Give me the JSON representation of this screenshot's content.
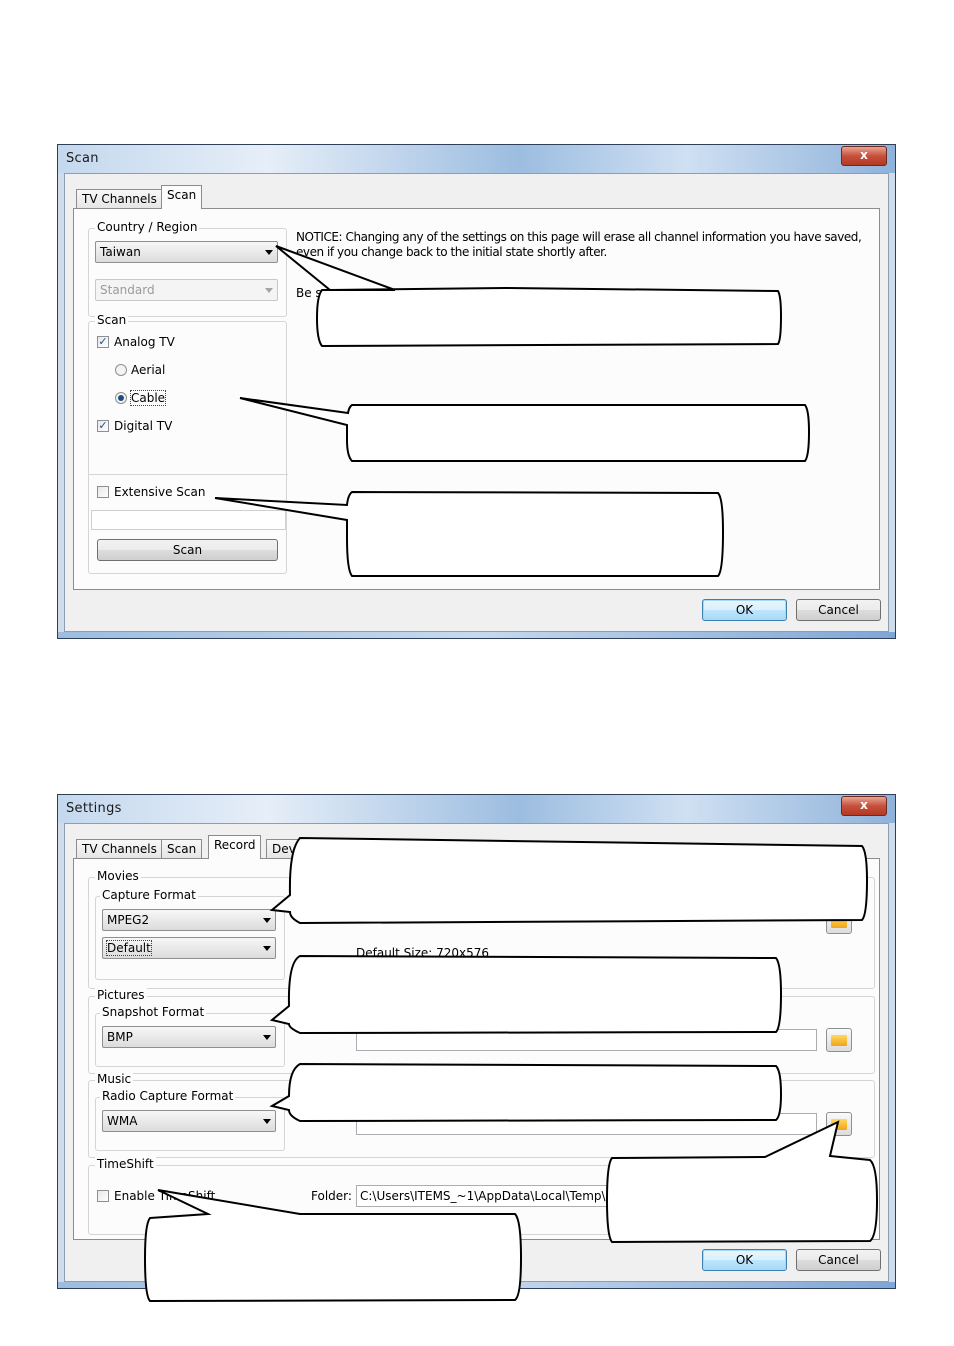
{
  "scan_dialog": {
    "title": "Scan",
    "close_glyph": "x",
    "tabs": [
      "TV Channels",
      "Scan"
    ],
    "country_group_label": "Country / Region",
    "country_value": "Taiwan",
    "standard_value": "Standard",
    "notice_line1": "NOTICE: Changing any of the settings on this page will erase all channel information you have saved,",
    "notice_line2": "even if you change back to the initial state shortly after.",
    "be_sure_text": "Be su",
    "scan_group_label": "Scan",
    "analog_tv_label": "Analog TV",
    "analog_tv_checked": true,
    "aerial_label": "Aerial",
    "cable_label": "Cable",
    "cable_selected": true,
    "digital_tv_label": "Digital TV",
    "digital_tv_checked": true,
    "extensive_scan_label": "Extensive Scan",
    "extensive_scan_checked": false,
    "scan_button": "Scan",
    "ok_button": "OK",
    "cancel_button": "Cancel"
  },
  "settings_dialog": {
    "title": "Settings",
    "close_glyph": "x",
    "tabs": [
      "TV Channels",
      "Scan",
      "Record",
      "Devi"
    ],
    "movies_label": "Movies",
    "capture_format_label": "Capture Format",
    "capture_format_value": "MPEG2",
    "capture_quality_value": "Default",
    "default_size_text": "Default Size: 720x576",
    "pictures_label": "Pictures",
    "snapshot_format_label": "Snapshot Format",
    "snapshot_format_value": "BMP",
    "music_label": "Music",
    "radio_capture_format_label": "Radio Capture Format",
    "radio_capture_format_value": "WMA",
    "timeshift_label": "TimeShift",
    "enable_timeshift_label": "Enable TimeShift",
    "enable_timeshift_checked": false,
    "folder_label": "Folder:",
    "timeshift_folder_value": "C:\\Users\\ITEMS_~1\\AppData\\Local\\Temp\\",
    "ok_button": "OK",
    "cancel_button": "Cancel"
  },
  "colors": {
    "title_gradient": "#9cbde0",
    "close_button": "#c7503b",
    "check_mark": "#1b4f8f",
    "default_button": "#3c7fb1"
  }
}
